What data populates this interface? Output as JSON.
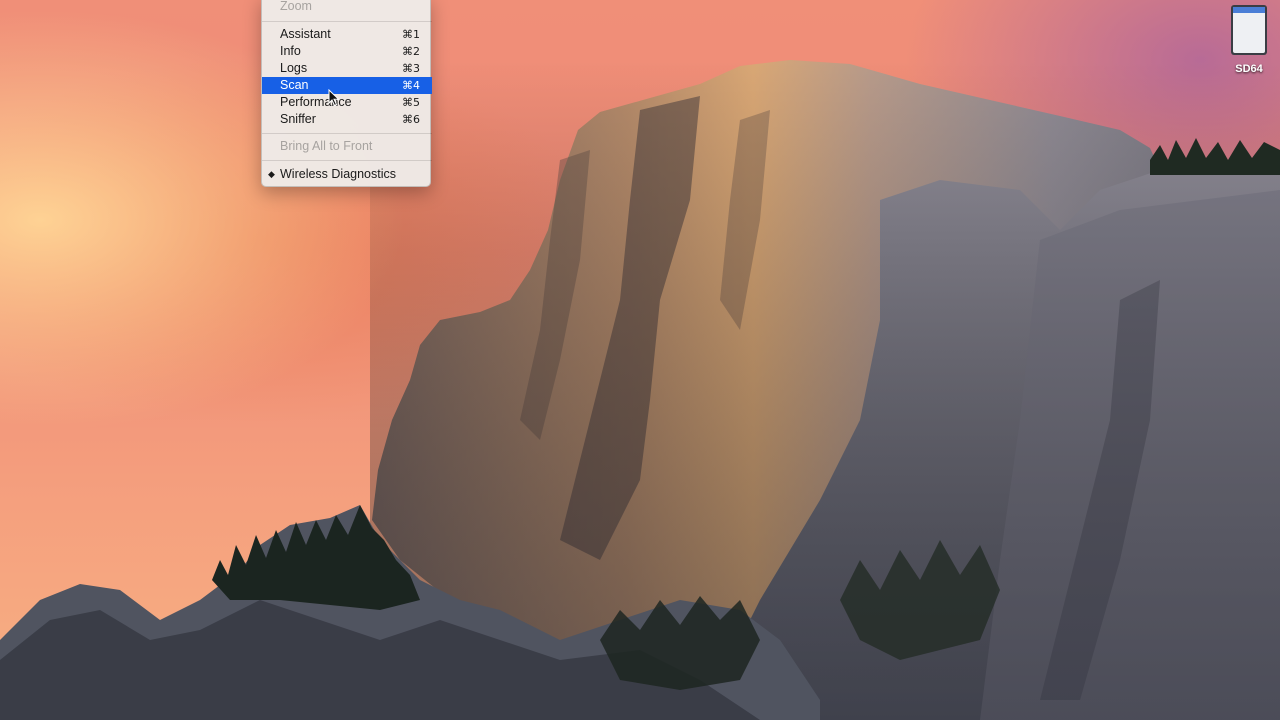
{
  "menu": {
    "zoom": "Zoom",
    "items": [
      {
        "label": "Assistant",
        "shortcut": "⌘1"
      },
      {
        "label": "Info",
        "shortcut": "⌘2"
      },
      {
        "label": "Logs",
        "shortcut": "⌘3"
      },
      {
        "label": "Scan",
        "shortcut": "⌘4"
      },
      {
        "label": "Performance",
        "shortcut": "⌘5"
      },
      {
        "label": "Sniffer",
        "shortcut": "⌘6"
      }
    ],
    "bring_all": "Bring All to Front",
    "window": "Wireless Diagnostics",
    "window_marker": "◆",
    "selected_item": "Scan",
    "selection_color": "#1760e6"
  },
  "desktop": {
    "drive_label": "SD64",
    "wallpaper": "mountain landscape at sunset"
  }
}
